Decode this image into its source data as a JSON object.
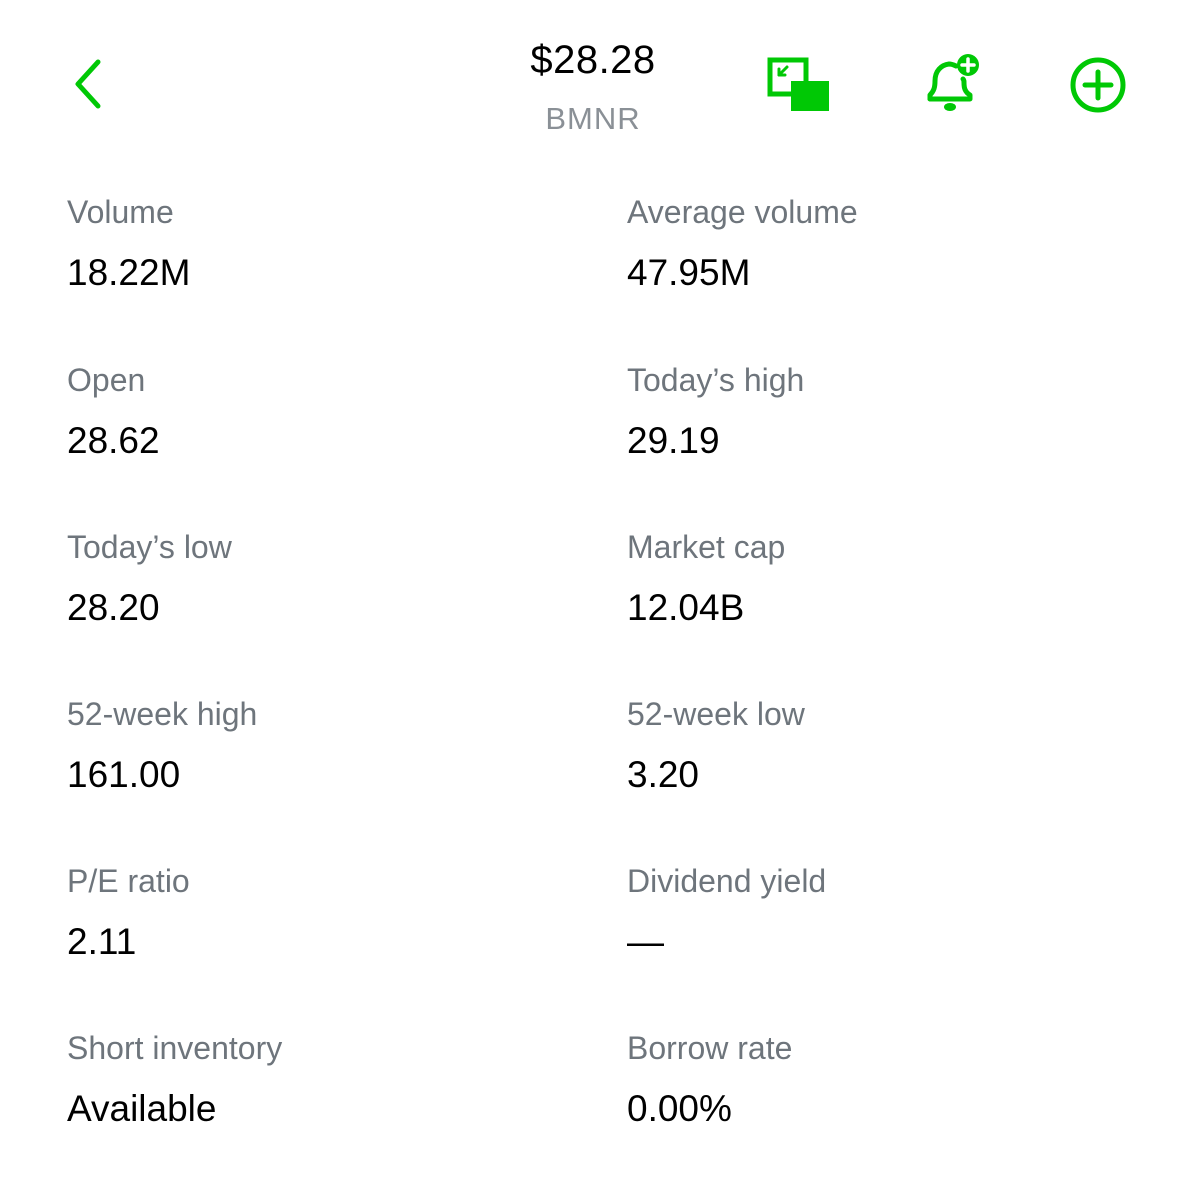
{
  "header": {
    "price": "$28.28",
    "ticker": "BMNR",
    "back_icon": "chevron-left-icon",
    "pip_icon": "picture-in-picture-icon",
    "alert_icon": "bell-plus-icon",
    "add_icon": "plus-circle-icon",
    "accent_color": "#00c805"
  },
  "stats": {
    "volume": {
      "label": "Volume",
      "value": "18.22M"
    },
    "average_volume": {
      "label": "Average volume",
      "value": "47.95M"
    },
    "open": {
      "label": "Open",
      "value": "28.62"
    },
    "todays_high": {
      "label": "Today’s high",
      "value": "29.19"
    },
    "todays_low": {
      "label": "Today’s low",
      "value": "28.20"
    },
    "market_cap": {
      "label": "Market cap",
      "value": "12.04B"
    },
    "week52_high": {
      "label": "52-week high",
      "value": "161.00"
    },
    "week52_low": {
      "label": "52-week low",
      "value": "3.20"
    },
    "pe_ratio": {
      "label": "P/E ratio",
      "value": "2.11"
    },
    "dividend_yield": {
      "label": "Dividend yield",
      "value": "—"
    },
    "short_inventory": {
      "label": "Short inventory",
      "value": "Available"
    },
    "borrow_rate": {
      "label": "Borrow rate",
      "value": "0.00%"
    }
  }
}
